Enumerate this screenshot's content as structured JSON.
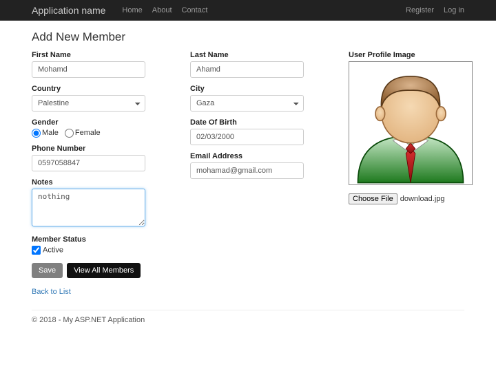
{
  "nav": {
    "brand": "Application name",
    "links": {
      "home": "Home",
      "about": "About",
      "contact": "Contact"
    },
    "right": {
      "register": "Register",
      "login": "Log in"
    }
  },
  "page": {
    "title": "Add New Member",
    "labels": {
      "first_name": "First Name",
      "last_name": "Last Name",
      "country": "Country",
      "city": "City",
      "gender": "Gender",
      "dob": "Date Of Birth",
      "phone": "Phone Number",
      "email": "Email Address",
      "notes": "Notes",
      "status": "Member Status",
      "profile_image": "User Profile Image"
    },
    "values": {
      "first_name": "Mohamd",
      "last_name": "Ahamd",
      "country": "Palestine",
      "city": "Gaza",
      "gender_male": "Male",
      "gender_female": "Female",
      "gender_selected": "male",
      "dob": "02/03/2000",
      "phone": "0597058847",
      "email": "mohamad@gmail.com",
      "notes": "nothing",
      "active_label": "Active",
      "active_checked": true
    },
    "buttons": {
      "save": "Save",
      "view_all": "View All Members",
      "back": "Back to List",
      "choose_file": "Choose File",
      "file_name": "download.jpg"
    }
  },
  "footer": "© 2018 - My ASP.NET Application"
}
